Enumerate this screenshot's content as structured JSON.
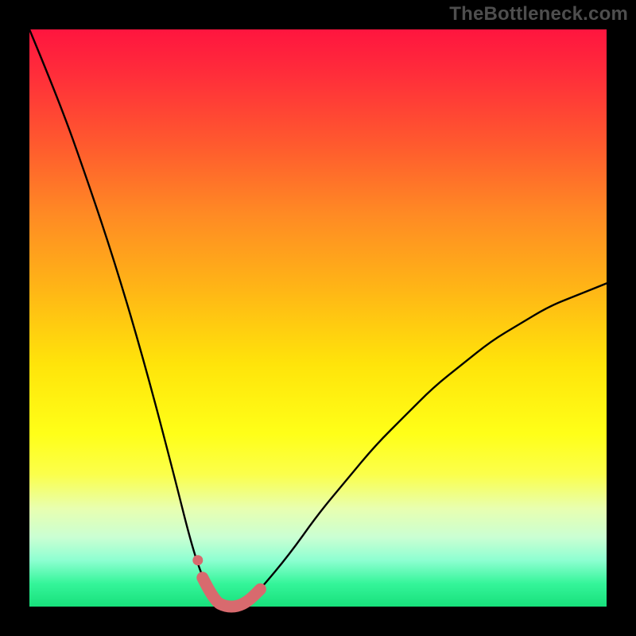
{
  "watermark": "TheBottleneck.com",
  "colors": {
    "frame": "#000000",
    "curve": "#000000",
    "pink_overlay": "#d86a6e",
    "gradient_top": "#ff153f",
    "gradient_bottom": "#17e07b"
  },
  "chart_data": {
    "type": "line",
    "title": "",
    "xlabel": "",
    "ylabel": "",
    "xlim": [
      0,
      100
    ],
    "ylim": [
      0,
      100
    ],
    "note": "V-shaped bottleneck curve. y≈100 at x=0, drops to ~0 near x≈33, rises back toward ~55 at x=100. Values estimated from pixels (no axis ticks shown).",
    "series": [
      {
        "name": "bottleneck-curve",
        "x": [
          0,
          5,
          10,
          15,
          20,
          25,
          28,
          30,
          32,
          34,
          36,
          38,
          40,
          45,
          50,
          55,
          60,
          65,
          70,
          75,
          80,
          85,
          90,
          95,
          100
        ],
        "y": [
          100,
          88,
          74,
          59,
          42,
          23,
          11,
          5,
          1,
          0,
          0,
          1,
          3,
          9,
          16,
          22,
          28,
          33,
          38,
          42,
          46,
          49,
          52,
          54,
          56
        ]
      }
    ],
    "pink_trough_overlay": {
      "x_range": [
        28.5,
        40
      ],
      "description": "Thick pink rounded stroke overlaying the bottom of the V"
    }
  }
}
